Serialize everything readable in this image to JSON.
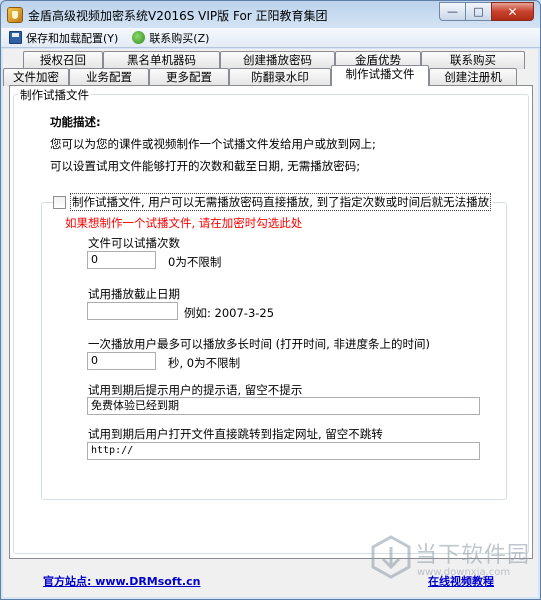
{
  "window": {
    "title": "金盾高级视频加密系统V2016S VIP版 For 正阳教育集团",
    "minimize": "—",
    "maximize": "□",
    "close": "✕"
  },
  "menu": {
    "save_label": "保存和加载配置(Y)",
    "buy_label": "联系购买(Z)"
  },
  "tabs": {
    "row1": [
      "授权召回",
      "黑名单机器码",
      "创建播放密码",
      "金盾优势",
      "联系购买"
    ],
    "row2": [
      "文件加密",
      "业务配置",
      "更多配置",
      "防翻录水印",
      "制作试播文件",
      "创建注册机"
    ],
    "active": "制作试播文件"
  },
  "panel": {
    "group_title": "制作试播文件",
    "heading": "功能描述:",
    "desc1": "您可以为您的课件或视频制作一个试播文件发给用户或放到网上;",
    "desc2": "可以设置试用文件能够打开的次数和截至日期, 无需播放密码;",
    "checkbox_label": "制作试播文件, 用户可以无需播放密码直接播放, 到了指定次数或时间后就无法播放",
    "checkbox_checked": false,
    "hint": "如果想制作一个试播文件, 请在加密时勾选此处",
    "count_label": "文件可以试播次数",
    "count_value": "0",
    "count_note": "0为不限制",
    "date_label": "试用播放截止日期",
    "date_value": "",
    "date_example": "例如: 2007-3-25",
    "time_label": "一次播放用户最多可以播放多长时间 (打开时间, 非进度条上的时间)",
    "time_value": "0",
    "time_note": "秒, 0为不限制",
    "expire_msg_label": "试用到期后提示用户的提示语, 留空不提示",
    "expire_msg_value": "免费体验已经到期",
    "expire_url_label": "试用到期后用户打开文件直接跳转到指定网址, 留空不跳转",
    "expire_url_value": "http://"
  },
  "footer": {
    "site_link": "官方站点: www.DRMsoft.cn",
    "video_link": "在线视频教程"
  },
  "watermark": {
    "text": "当下软件园",
    "sub": "www.downxia.com"
  }
}
